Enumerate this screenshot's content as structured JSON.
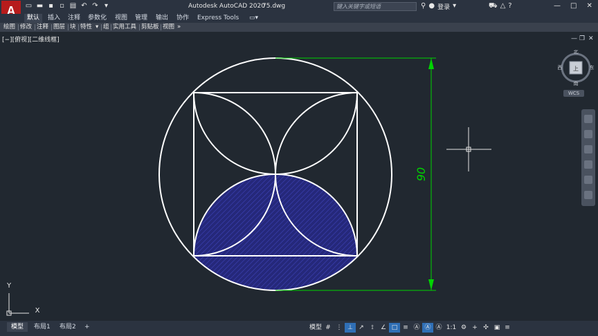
{
  "app": {
    "title": "Autodesk AutoCAD 2020",
    "file": "75.dwg",
    "logo_letter": "A"
  },
  "search": {
    "placeholder": "键入关键字或短语"
  },
  "account": {
    "login": "登录"
  },
  "ribbon_tabs": [
    "默认",
    "插入",
    "注释",
    "参数化",
    "视图",
    "管理",
    "输出",
    "协作",
    "Express Tools"
  ],
  "ribbon_panels": [
    "绘图",
    "修改",
    "注释",
    "图层",
    "块",
    "特性",
    "组",
    "实用工具",
    "剪贴板",
    "视图"
  ],
  "viewport": {
    "label": "[−][俯视][二维线框]"
  },
  "viewcube": {
    "north": "北",
    "south": "南",
    "east": "东",
    "west": "西",
    "top": "上",
    "wcs": "WCS"
  },
  "dimension": {
    "value": "90"
  },
  "ucs": {
    "x": "X",
    "y": "Y"
  },
  "layout_tabs": [
    "模型",
    "布局1",
    "布局2"
  ],
  "statusbar": {
    "model": "模型",
    "scale": "1:1"
  },
  "colors": {
    "background": "#212830",
    "geometry": "#ffffff",
    "dimension": "#00d400",
    "hatch": "#2b2f8c"
  },
  "icons": [
    "new-icon",
    "open-icon",
    "save-icon",
    "saveas-icon",
    "plot-icon",
    "undo-icon",
    "redo-icon",
    "exchange-icon",
    "user-icon",
    "cart-icon",
    "help-icon",
    "minimize-icon",
    "maximize-icon",
    "close-icon"
  ]
}
